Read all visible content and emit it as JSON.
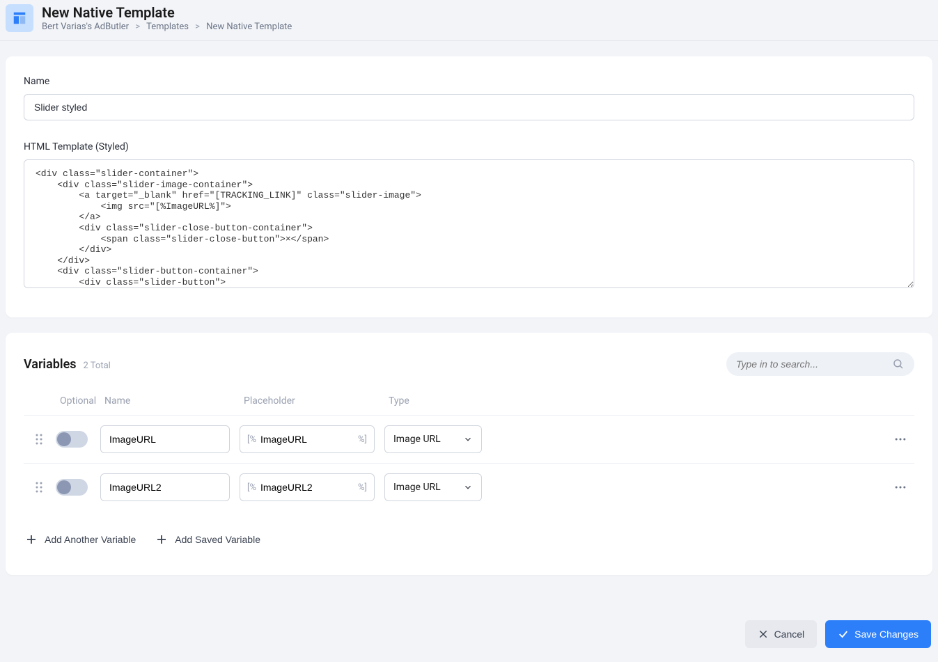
{
  "header": {
    "title": "New Native Template",
    "breadcrumb": [
      "Bert Varias's AdButler",
      "Templates",
      "New Native Template"
    ]
  },
  "form": {
    "name_label": "Name",
    "name_value": "Slider styled",
    "template_label": "HTML Template (Styled)",
    "template_value": "<div class=\"slider-container\">\n    <div class=\"slider-image-container\">\n        <a target=\"_blank\" href=\"[TRACKING_LINK]\" class=\"slider-image\">\n            <img src=\"[%ImageURL%]\">\n        </a>\n        <div class=\"slider-close-button-container\">\n            <span class=\"slider-close-button\">×</span>\n        </div>\n    </div>\n    <div class=\"slider-button-container\">\n        <div class=\"slider-button\">"
  },
  "variables": {
    "title": "Variables",
    "count_label": "2 Total",
    "search_placeholder": "Type in to search...",
    "columns": {
      "optional": "Optional",
      "name": "Name",
      "placeholder": "Placeholder",
      "type": "Type"
    },
    "placeholder_prefix": "[%",
    "placeholder_suffix": "%]",
    "rows": [
      {
        "optional": false,
        "name": "ImageURL",
        "placeholder": "ImageURL",
        "type": "Image URL"
      },
      {
        "optional": false,
        "name": "ImageURL2",
        "placeholder": "ImageURL2",
        "type": "Image URL"
      }
    ],
    "add_another_label": "Add Another Variable",
    "add_saved_label": "Add Saved Variable"
  },
  "footer": {
    "cancel_label": "Cancel",
    "save_label": "Save Changes"
  }
}
